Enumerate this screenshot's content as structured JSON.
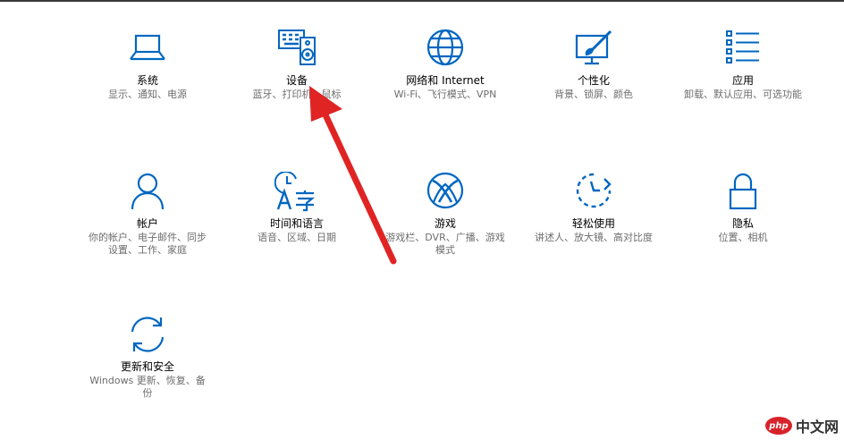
{
  "accent_color": "#0067c0",
  "arrow_color": "#e02424",
  "tiles": [
    {
      "id": "system",
      "title": "系统",
      "desc": "显示、通知、电源",
      "icon": "laptop-icon"
    },
    {
      "id": "devices",
      "title": "设备",
      "desc": "蓝牙、打印机、鼠标",
      "icon": "keyboard-speaker-icon"
    },
    {
      "id": "network",
      "title": "网络和 Internet",
      "desc": "Wi-Fi、飞行模式、VPN",
      "icon": "globe-icon"
    },
    {
      "id": "personalization",
      "title": "个性化",
      "desc": "背景、锁屏、颜色",
      "icon": "paint-monitor-icon"
    },
    {
      "id": "apps",
      "title": "应用",
      "desc": "卸载、默认应用、可选功能",
      "icon": "app-list-icon"
    },
    {
      "id": "accounts",
      "title": "帐户",
      "desc": "你的帐户、电子邮件、同步设置、工作、家庭",
      "icon": "person-icon"
    },
    {
      "id": "time-language",
      "title": "时间和语言",
      "desc": "语音、区域、日期",
      "icon": "time-language-icon"
    },
    {
      "id": "gaming",
      "title": "游戏",
      "desc": "游戏栏、DVR、广播、游戏模式",
      "icon": "xbox-icon"
    },
    {
      "id": "ease-of-access",
      "title": "轻松使用",
      "desc": "讲述人、放大镜、高对比度",
      "icon": "ease-of-access-icon"
    },
    {
      "id": "privacy",
      "title": "隐私",
      "desc": "位置、相机",
      "icon": "lock-icon"
    },
    {
      "id": "update-security",
      "title": "更新和安全",
      "desc": "Windows 更新、恢复、备份",
      "icon": "sync-icon"
    }
  ],
  "watermark": {
    "badge": "php",
    "text": "中文网"
  }
}
